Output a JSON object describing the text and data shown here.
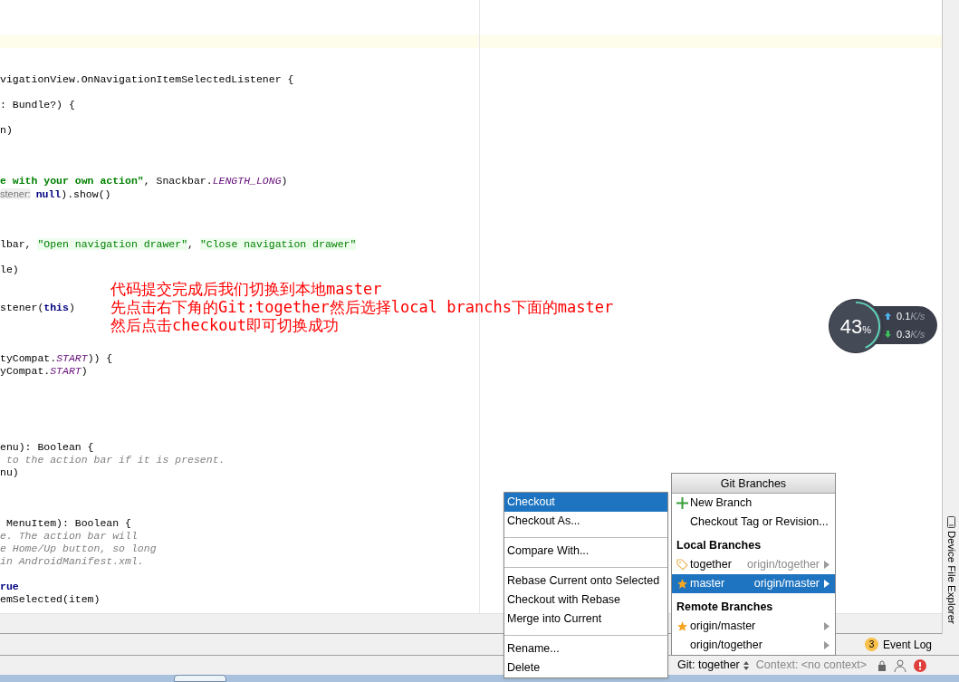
{
  "editor": {
    "code_lines": [
      {
        "kind": "current"
      },
      {
        "kind": "blank"
      },
      {
        "kind": "blank"
      },
      {
        "kind": "code",
        "segments": [
          {
            "kind": "plain",
            "text": "vigationView.OnNavigationItemSelectedListener {"
          }
        ]
      },
      {
        "kind": "blank"
      },
      {
        "kind": "code",
        "segments": [
          {
            "kind": "plain",
            "text": ": Bundle?) {"
          }
        ]
      },
      {
        "kind": "blank"
      },
      {
        "kind": "code",
        "segments": [
          {
            "kind": "plain",
            "text": "n)"
          }
        ]
      },
      {
        "kind": "blank"
      },
      {
        "kind": "blank"
      },
      {
        "kind": "blank"
      },
      {
        "kind": "code",
        "segments": [
          {
            "kind": "string",
            "text": "e with your own action\""
          },
          {
            "kind": "plain",
            "text": ", Snackbar."
          },
          {
            "kind": "constant",
            "text": "LENGTH_LONG"
          },
          {
            "kind": "plain",
            "text": ")"
          }
        ]
      },
      {
        "kind": "code",
        "segments": [
          {
            "kind": "hint",
            "text": "stener:"
          },
          {
            "kind": "keyword",
            "text": "null"
          },
          {
            "kind": "plain",
            "text": ").show()"
          }
        ]
      },
      {
        "kind": "blank"
      },
      {
        "kind": "blank"
      },
      {
        "kind": "blank"
      },
      {
        "kind": "code",
        "segments": [
          {
            "kind": "plain",
            "text": "lbar, "
          },
          {
            "kind": "quoted",
            "text": "\"Open navigation drawer\""
          },
          {
            "kind": "plain",
            "text": ", "
          },
          {
            "kind": "quoted",
            "text": "\"Close navigation drawer\""
          }
        ]
      },
      {
        "kind": "blank"
      },
      {
        "kind": "code",
        "segments": [
          {
            "kind": "plain",
            "text": "le)"
          }
        ]
      },
      {
        "kind": "blank"
      },
      {
        "kind": "blank"
      },
      {
        "kind": "code",
        "segments": [
          {
            "kind": "plain",
            "text": "stener("
          },
          {
            "kind": "keyword",
            "text": "this"
          },
          {
            "kind": "plain",
            "text": ")"
          }
        ]
      },
      {
        "kind": "blank"
      },
      {
        "kind": "blank"
      },
      {
        "kind": "blank"
      },
      {
        "kind": "code",
        "segments": [
          {
            "kind": "plain",
            "text": "tyCompat."
          },
          {
            "kind": "constant",
            "text": "START"
          },
          {
            "kind": "plain",
            "text": ")) {"
          }
        ]
      },
      {
        "kind": "code",
        "segments": [
          {
            "kind": "plain",
            "text": "yCompat."
          },
          {
            "kind": "constant",
            "text": "START"
          },
          {
            "kind": "plain",
            "text": ")"
          }
        ]
      },
      {
        "kind": "blank"
      },
      {
        "kind": "blank"
      },
      {
        "kind": "blank"
      },
      {
        "kind": "blank"
      },
      {
        "kind": "blank"
      },
      {
        "kind": "code",
        "segments": [
          {
            "kind": "plain",
            "text": "enu): Boolean {"
          }
        ]
      },
      {
        "kind": "code",
        "segments": [
          {
            "kind": "comment",
            "text": " to the action bar if it is present."
          }
        ]
      },
      {
        "kind": "code",
        "segments": [
          {
            "kind": "plain",
            "text": "nu)"
          }
        ]
      },
      {
        "kind": "blank"
      },
      {
        "kind": "blank"
      },
      {
        "kind": "blank"
      },
      {
        "kind": "code",
        "segments": [
          {
            "kind": "plain",
            "text": " MenuItem): Boolean {"
          }
        ]
      },
      {
        "kind": "code",
        "segments": [
          {
            "kind": "comment",
            "text": "e. The action bar will"
          }
        ]
      },
      {
        "kind": "code",
        "segments": [
          {
            "kind": "comment",
            "text": "e Home/Up button, so long"
          }
        ]
      },
      {
        "kind": "code",
        "segments": [
          {
            "kind": "comment",
            "text": "in AndroidManifest.xml."
          }
        ]
      },
      {
        "kind": "blank"
      },
      {
        "kind": "code",
        "segments": [
          {
            "kind": "keyword",
            "text": "rue"
          }
        ]
      },
      {
        "kind": "code",
        "segments": [
          {
            "kind": "plain",
            "text": "emSelected(item)"
          }
        ]
      }
    ]
  },
  "annotation": [
    "代码提交完成后我们切换到本地master",
    "先点击右下角的Git:together然后选择local branchs下面的master",
    "然后点击checkout即可切换成功"
  ],
  "speed_widget": {
    "percent": "43",
    "percent_sign": "%",
    "level": 0.43,
    "upload": "0.1",
    "upload_unit": "K/s",
    "download": "0.3",
    "download_unit": "K/s"
  },
  "right_tool_strip": {
    "label": "Device File Explorer"
  },
  "branch_actions_menu": {
    "groups": [
      [
        {
          "label": "Checkout",
          "selected": true
        },
        {
          "label": "Checkout As...",
          "selected": false
        }
      ],
      [
        {
          "label": "Compare With...",
          "selected": false
        }
      ],
      [
        {
          "label": "Rebase Current onto Selected",
          "selected": false
        },
        {
          "label": "Checkout with Rebase",
          "selected": false
        },
        {
          "label": "Merge into Current",
          "selected": false
        }
      ],
      [
        {
          "label": "Rename...",
          "selected": false
        },
        {
          "label": "Delete",
          "selected": false
        }
      ]
    ]
  },
  "git_branches_popup": {
    "title": "Git Branches",
    "items": [
      {
        "kind": "create",
        "label": "New Branch",
        "selected": false
      },
      {
        "kind": "action",
        "label": "Checkout Tag or Revision...",
        "selected": false
      },
      {
        "kind": "header",
        "label": "Local Branches"
      },
      {
        "kind": "branch",
        "label": "together",
        "tracking": "origin/together",
        "current": true,
        "selected": false
      },
      {
        "kind": "branch",
        "label": "master",
        "tracking": "origin/master",
        "current": false,
        "favorite": true,
        "selected": true
      },
      {
        "kind": "header",
        "label": "Remote Branches"
      },
      {
        "kind": "branch",
        "label": "origin/master",
        "current": false,
        "favorite": true,
        "selected": false
      },
      {
        "kind": "branch",
        "label": "origin/together",
        "current": false,
        "favorite": false,
        "selected": false
      }
    ]
  },
  "event_log": {
    "count": "3",
    "label": "Event Log"
  },
  "status_bar": {
    "git_branch": "Git: together",
    "context": "Context: <no context>"
  }
}
